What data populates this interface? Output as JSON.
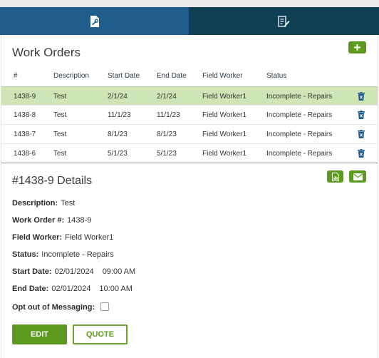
{
  "tabs": [
    {
      "icon": "wrench-document-icon",
      "active": true
    },
    {
      "icon": "edit-document-icon",
      "active": false
    }
  ],
  "colors": {
    "tab_active": "#1f5d8c",
    "tab_inactive": "#0e3f55",
    "accent": "#5c9a1e",
    "selected_row": "#cfe5b5",
    "trash": "#1f5d8c"
  },
  "work_orders": {
    "title": "Work Orders",
    "add_icon": "plus-icon",
    "columns": [
      "#",
      "Description",
      "Start Date",
      "End Date",
      "Field Worker",
      "Status"
    ],
    "rows": [
      {
        "id": "1438-9",
        "description": "Test",
        "start": "2/1/24",
        "end": "2/1/24",
        "worker": "Field Worker1",
        "status": "Incomplete - Repairs",
        "selected": true
      },
      {
        "id": "1438-8",
        "description": "Test",
        "start": "11/1/23",
        "end": "11/1/23",
        "worker": "Field Worker1",
        "status": "Incomplete - Repairs",
        "selected": false
      },
      {
        "id": "1438-7",
        "description": "Test",
        "start": "8/1/23",
        "end": "8/1/23",
        "worker": "Field Worker1",
        "status": "Incomplete - Repairs",
        "selected": false
      },
      {
        "id": "1438-6",
        "description": "Test",
        "start": "5/1/23",
        "end": "5/1/23",
        "worker": "Field Worker1",
        "status": "Incomplete - Repairs",
        "selected": false
      }
    ]
  },
  "details": {
    "title": "#1438-9 Details",
    "pdf_icon": "report-icon",
    "mail_icon": "envelope-icon",
    "description_label": "Description:",
    "description_value": "Test",
    "work_order_label": "Work Order #:",
    "work_order_value": "1438-9",
    "field_worker_label": "Field Worker:",
    "field_worker_value": "Field Worker1",
    "status_label": "Status:",
    "status_value": "Incomplete - Repairs",
    "start_date_label": "Start Date:",
    "start_date_value": "02/01/2024",
    "start_time_value": "09:00 AM",
    "end_date_label": "End Date:",
    "end_date_value": "02/01/2024",
    "end_time_value": "10:00 AM",
    "opt_out_label": "Opt out of Messaging:",
    "opt_out_checked": false,
    "edit_label": "EDIT",
    "quote_label": "QUOTE"
  }
}
